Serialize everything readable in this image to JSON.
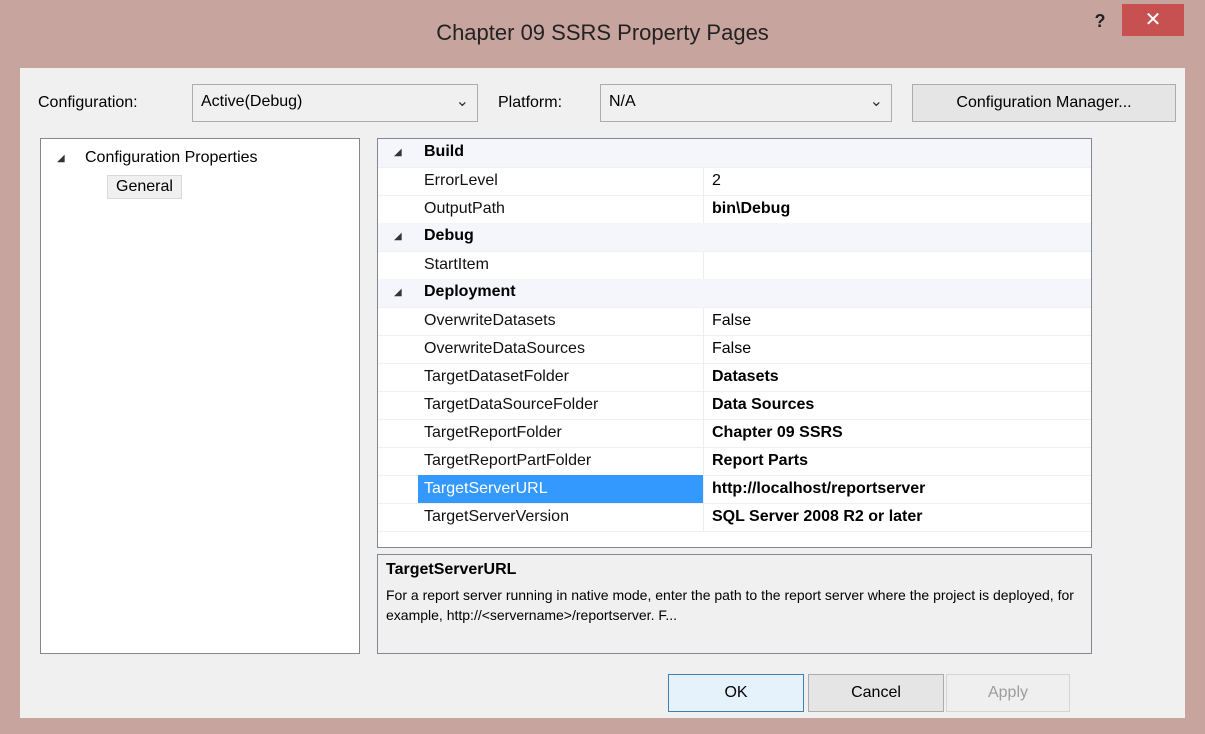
{
  "window": {
    "title": "Chapter 09 SSRS Property Pages",
    "help_label": "?",
    "close_label": "✕"
  },
  "config": {
    "configuration_label": "Configuration:",
    "configuration_value": "Active(Debug)",
    "platform_label": "Platform:",
    "platform_value": "N/A",
    "manager_button": "Configuration Manager..."
  },
  "tree": {
    "expander": "◢",
    "root": "Configuration Properties",
    "child": "General"
  },
  "grid": {
    "expander": "◢",
    "categories": {
      "build": "Build",
      "debug": "Debug",
      "deployment": "Deployment"
    },
    "rows": {
      "error_level": {
        "name": "ErrorLevel",
        "value": "2"
      },
      "output_path": {
        "name": "OutputPath",
        "value": "bin\\Debug"
      },
      "start_item": {
        "name": "StartItem",
        "value": ""
      },
      "overwrite_datasets": {
        "name": "OverwriteDatasets",
        "value": "False"
      },
      "overwrite_datasources": {
        "name": "OverwriteDataSources",
        "value": "False"
      },
      "target_dataset_folder": {
        "name": "TargetDatasetFolder",
        "value": "Datasets"
      },
      "target_datasource_folder": {
        "name": "TargetDataSourceFolder",
        "value": "Data Sources"
      },
      "target_report_folder": {
        "name": "TargetReportFolder",
        "value": "Chapter 09 SSRS"
      },
      "target_reportpart_folder": {
        "name": "TargetReportPartFolder",
        "value": "Report Parts"
      },
      "target_server_url": {
        "name": "TargetServerURL",
        "value": "http://localhost/reportserver"
      },
      "target_server_version": {
        "name": "TargetServerVersion",
        "value": "SQL Server 2008 R2 or later"
      }
    }
  },
  "description": {
    "title": "TargetServerURL",
    "text": "For a report server running in native mode, enter the path to the report server where the project is deployed, for example, http://<servername>/reportserver. F..."
  },
  "buttons": {
    "ok": "OK",
    "cancel": "Cancel",
    "apply": "Apply"
  },
  "colors": {
    "titlebar": "#c7a49e",
    "close": "#c75050",
    "selection": "#3399ff",
    "ok_border": "#3c7fb1"
  }
}
